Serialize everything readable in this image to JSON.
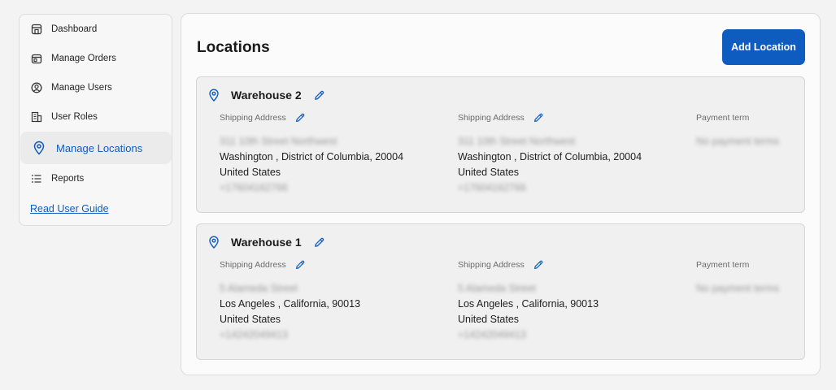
{
  "sidebar": {
    "items": [
      {
        "label": "Dashboard",
        "icon": "dashboard-icon",
        "active": false
      },
      {
        "label": "Manage Orders",
        "icon": "orders-icon",
        "active": false
      },
      {
        "label": "Manage Users",
        "icon": "user-icon",
        "active": false
      },
      {
        "label": "User Roles",
        "icon": "building-icon",
        "active": false
      },
      {
        "label": "Manage Locations",
        "icon": "location-pin-icon",
        "active": true
      },
      {
        "label": "Reports",
        "icon": "list-icon",
        "active": false
      }
    ],
    "guide_link": "Read User Guide"
  },
  "main": {
    "title": "Locations",
    "add_button": "Add Location",
    "locations": [
      {
        "name": "Warehouse 2",
        "shipping1": {
          "label": "Shipping Address",
          "street": "311 10th Street Northwest",
          "city_line": "Washington , District of Columbia, 20004",
          "country": "United States",
          "phone": "+17604162766"
        },
        "shipping2": {
          "label": "Shipping Address",
          "street": "311 10th Street Northwest",
          "city_line": "Washington , District of Columbia, 20004",
          "country": "United States",
          "phone": "+17604162766"
        },
        "payment": {
          "label": "Payment term",
          "value": "No payment terms"
        }
      },
      {
        "name": "Warehouse 1",
        "shipping1": {
          "label": "Shipping Address",
          "street": "5 Alameda Street",
          "city_line": "Los Angeles , California, 90013",
          "country": "United States",
          "phone": "+14242049413"
        },
        "shipping2": {
          "label": "Shipping Address",
          "street": "5 Alameda Street",
          "city_line": "Los Angeles , California, 90013",
          "country": "United States",
          "phone": "+14242049413"
        },
        "payment": {
          "label": "Payment term",
          "value": "No payment terms"
        }
      }
    ]
  },
  "colors": {
    "accent": "#0f5cc0",
    "background": "#f3f3f3",
    "card": "#f0f0f0"
  }
}
